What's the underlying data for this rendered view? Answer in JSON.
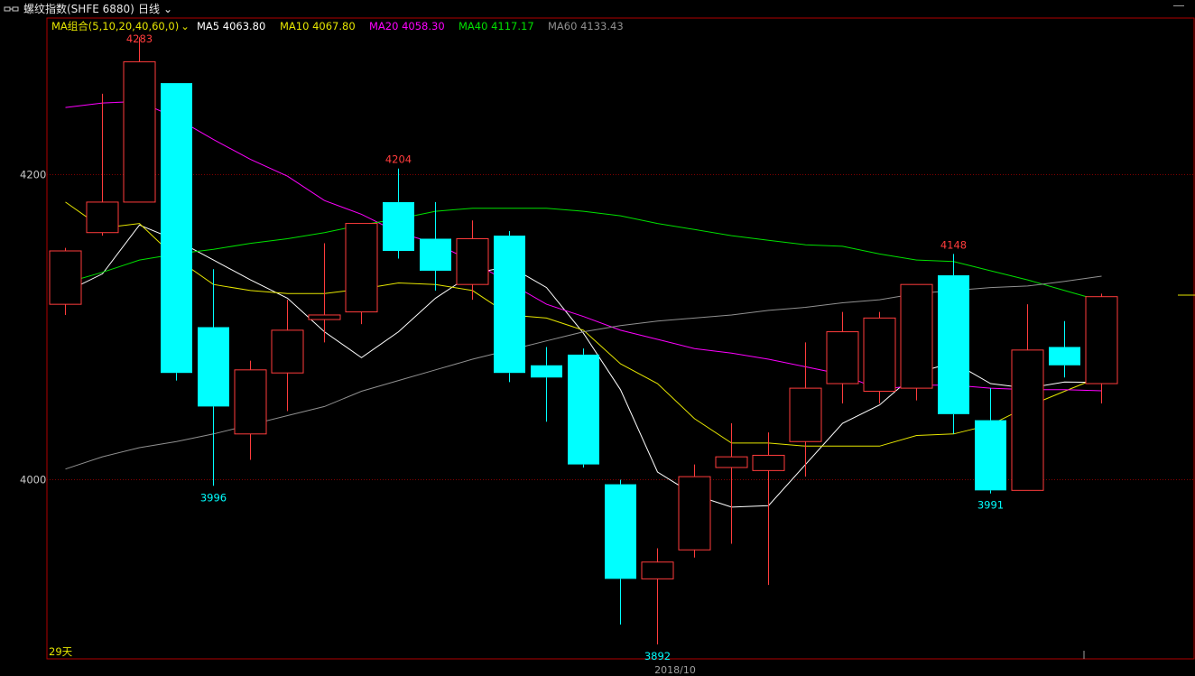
{
  "header": {
    "instrument": "螺纹指数(SHFE 6880)",
    "period": "日线",
    "icon": "window-toggle-icon"
  },
  "ma_legend": {
    "group_label": "MA组合(5,10,20,40,60,0)",
    "items": [
      {
        "label": "MA5 4063.80",
        "color": "#ffffff"
      },
      {
        "label": "MA10 4067.80",
        "color": "#e6e600"
      },
      {
        "label": "MA20 4058.30",
        "color": "#ff00ff"
      },
      {
        "label": "MA40 4117.17",
        "color": "#00e000"
      },
      {
        "label": "MA60 4133.43",
        "color": "#909090"
      }
    ]
  },
  "footer": {
    "day_count": "29天",
    "date_label": "2018/10"
  },
  "chart_data": {
    "type": "candlestick",
    "y_ticks": [
      4000,
      4200
    ],
    "ylim": [
      3880,
      4305
    ],
    "colors": {
      "up": "#ff3c3c",
      "down": "#00ffff",
      "grid": "#800000",
      "frame": "#b00000"
    },
    "annotations": [
      {
        "index": 2,
        "price": 4283,
        "label": "4283",
        "kind": "high"
      },
      {
        "index": 4,
        "price": 3996,
        "label": "3996",
        "kind": "low"
      },
      {
        "index": 9,
        "price": 4204,
        "label": "4204",
        "kind": "high"
      },
      {
        "index": 16,
        "price": 3892,
        "label": "3892",
        "kind": "low"
      },
      {
        "index": 24,
        "price": 4148,
        "label": "4148",
        "kind": "high"
      },
      {
        "index": 25,
        "price": 3991,
        "label": "3991",
        "kind": "low"
      }
    ],
    "candles": [
      {
        "o": 4115,
        "h": 4152,
        "l": 4108,
        "c": 4150
      },
      {
        "o": 4162,
        "h": 4253,
        "l": 4160,
        "c": 4182
      },
      {
        "o": 4182,
        "h": 4290,
        "l": 4182,
        "c": 4274
      },
      {
        "o": 4260,
        "h": 4260,
        "l": 4065,
        "c": 4070
      },
      {
        "o": 4100,
        "h": 4138,
        "l": 3996,
        "c": 4048
      },
      {
        "o": 4030,
        "h": 4078,
        "l": 4013,
        "c": 4072
      },
      {
        "o": 4070,
        "h": 4118,
        "l": 4045,
        "c": 4098
      },
      {
        "o": 4105,
        "h": 4155,
        "l": 4090,
        "c": 4108
      },
      {
        "o": 4110,
        "h": 4168,
        "l": 4102,
        "c": 4168
      },
      {
        "o": 4182,
        "h": 4204,
        "l": 4145,
        "c": 4150
      },
      {
        "o": 4158,
        "h": 4182,
        "l": 4124,
        "c": 4137
      },
      {
        "o": 4128,
        "h": 4170,
        "l": 4118,
        "c": 4158
      },
      {
        "o": 4160,
        "h": 4163,
        "l": 4064,
        "c": 4070
      },
      {
        "o": 4075,
        "h": 4087,
        "l": 4038,
        "c": 4067
      },
      {
        "o": 4082,
        "h": 4086,
        "l": 4008,
        "c": 4010
      },
      {
        "o": 3997,
        "h": 4000,
        "l": 3905,
        "c": 3935
      },
      {
        "o": 3935,
        "h": 3955,
        "l": 3892,
        "c": 3946
      },
      {
        "o": 3954,
        "h": 4010,
        "l": 3949,
        "c": 4002
      },
      {
        "o": 4008,
        "h": 4037,
        "l": 3958,
        "c": 4015
      },
      {
        "o": 4006,
        "h": 4031,
        "l": 3931,
        "c": 4016
      },
      {
        "o": 4025,
        "h": 4090,
        "l": 4002,
        "c": 4060
      },
      {
        "o": 4063,
        "h": 4110,
        "l": 4050,
        "c": 4097
      },
      {
        "o": 4058,
        "h": 4110,
        "l": 4050,
        "c": 4106
      },
      {
        "o": 4060,
        "h": 4128,
        "l": 4052,
        "c": 4128
      },
      {
        "o": 4134,
        "h": 4148,
        "l": 4030,
        "c": 4043
      },
      {
        "o": 4039,
        "h": 4060,
        "l": 3991,
        "c": 3993
      },
      {
        "o": 3993,
        "h": 4115,
        "l": 3993,
        "c": 4085
      },
      {
        "o": 4087,
        "h": 4104,
        "l": 4067,
        "c": 4075
      },
      {
        "o": 4063,
        "h": 4122,
        "l": 4050,
        "c": 4120
      }
    ],
    "ma_lines": [
      {
        "name": "MA5",
        "color": "#ffffff",
        "values": [
          4123,
          4135,
          4167,
          4157,
          4144,
          4131,
          4119,
          4097,
          4080,
          4097,
          4119,
          4135,
          4140,
          4126,
          4096,
          4059,
          4005,
          3990,
          3982,
          3983,
          4010,
          4037,
          4049,
          4070,
          4077,
          4063,
          4060,
          4064,
          4063.8
        ]
      },
      {
        "name": "MA10",
        "color": "#e6e600",
        "values": [
          4182,
          4165,
          4168,
          4145,
          4128,
          4124,
          4122,
          4122,
          4125,
          4129,
          4128,
          4124,
          4108,
          4106,
          4098,
          4076,
          4063,
          4040,
          4024,
          4024,
          4022,
          4022,
          4022,
          4029,
          4030,
          4036,
          4048,
          4058,
          4067.8
        ]
      },
      {
        "name": "MA20",
        "color": "#ff00ff",
        "values": [
          4244,
          4247,
          4248,
          4237,
          4223,
          4210,
          4199,
          4183,
          4174,
          4162,
          4155,
          4143,
          4129,
          4115,
          4107,
          4098,
          4092,
          4086,
          4083,
          4079,
          4074,
          4069,
          4059,
          4062,
          4062,
          4060,
          4059,
          4059,
          4058.3
        ]
      },
      {
        "name": "MA40",
        "color": "#00e000",
        "values": [
          4129,
          4136,
          4144,
          4148,
          4151,
          4155,
          4158,
          4162,
          4167,
          4171,
          4176,
          4178,
          4178,
          4178,
          4176,
          4173,
          4168,
          4164,
          4160,
          4157,
          4154,
          4153,
          4148,
          4144,
          4143,
          4137,
          4131,
          4124,
          4117.17
        ]
      },
      {
        "name": "MA60",
        "color": "#909090",
        "values": [
          4007,
          4015,
          4021,
          4025,
          4030,
          4036,
          4042,
          4048,
          4058,
          4065,
          4072,
          4079,
          4085,
          4091,
          4097,
          4101,
          4104,
          4106,
          4108,
          4111,
          4113,
          4116,
          4118,
          4122,
          4124,
          4126,
          4127,
          4130,
          4133.43
        ]
      }
    ]
  }
}
